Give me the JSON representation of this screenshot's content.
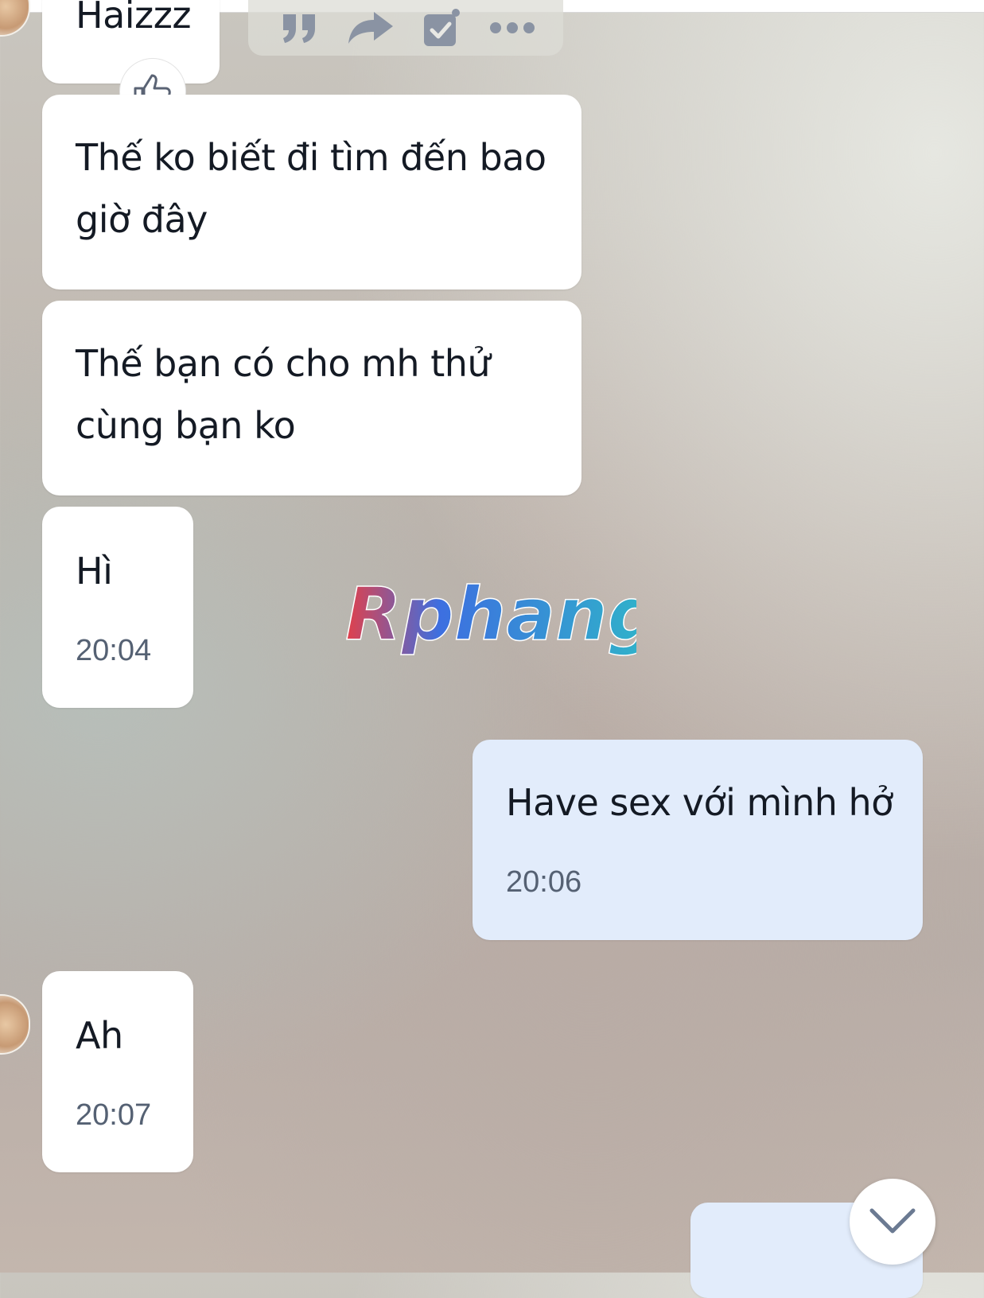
{
  "watermark": {
    "text": "Rphang"
  },
  "toolbar": {
    "icons": [
      "quote-icon",
      "forward-icon",
      "task-icon",
      "more-icon"
    ]
  },
  "messages": [
    {
      "direction": "in",
      "text": "Haizzz",
      "time": "",
      "reaction": "thumbs-up-icon"
    },
    {
      "direction": "in",
      "text": "Thế ko biết đi tìm đến bao giờ đây",
      "time": ""
    },
    {
      "direction": "in",
      "text": "Thế bạn có cho mh thử cùng bạn ko",
      "time": ""
    },
    {
      "direction": "in",
      "text": "Hì",
      "time": "20:04"
    },
    {
      "direction": "out",
      "text": "Have sex với mình hở",
      "time": "20:06"
    },
    {
      "direction": "in",
      "text": "Ah",
      "time": "20:07"
    }
  ],
  "colors": {
    "incoming_bubble": "#ffffff",
    "outgoing_bubble": "#e2ecfb",
    "time_text": "#556173"
  }
}
